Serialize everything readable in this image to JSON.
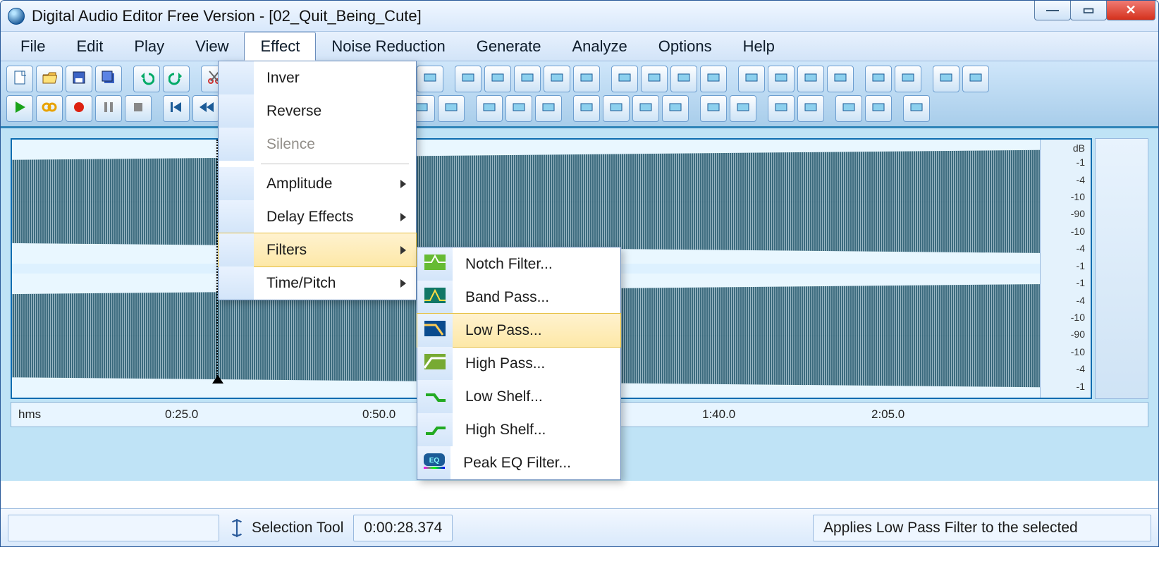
{
  "window": {
    "title": "Digital Audio Editor Free Version - [02_Quit_Being_Cute]"
  },
  "menubar": [
    "File",
    "Edit",
    "Play",
    "View",
    "Effect",
    "Noise Reduction",
    "Generate",
    "Analyze",
    "Options",
    "Help"
  ],
  "menubar_open": "Effect",
  "effect_menu": {
    "items": [
      {
        "label": "Inver",
        "kind": "item"
      },
      {
        "label": "Reverse",
        "kind": "item"
      },
      {
        "label": "Silence",
        "kind": "item",
        "disabled": true
      },
      {
        "kind": "sep"
      },
      {
        "label": "Amplitude",
        "kind": "sub"
      },
      {
        "label": "Delay Effects",
        "kind": "sub"
      },
      {
        "label": "Filters",
        "kind": "sub",
        "hover": true
      },
      {
        "label": "Time/Pitch",
        "kind": "sub"
      }
    ]
  },
  "filters_submenu": {
    "items": [
      {
        "label": "Notch Filter...",
        "icon": "notch"
      },
      {
        "label": "Band Pass...",
        "icon": "band"
      },
      {
        "label": "Low Pass...",
        "icon": "lowpass",
        "hover": true
      },
      {
        "label": "High Pass...",
        "icon": "highpass"
      },
      {
        "label": "Low Shelf...",
        "icon": "lowshelf"
      },
      {
        "label": "High Shelf...",
        "icon": "highshelf"
      },
      {
        "label": "Peak EQ Filter...",
        "icon": "eq"
      }
    ]
  },
  "toolbar_icons_row1": [
    "file-new",
    "file-open",
    "save",
    "save-all",
    "",
    "undo",
    "redo",
    "",
    "cut",
    "copy",
    "paste",
    "paste-new",
    "mix",
    "mix-new",
    "",
    "crop",
    "delete",
    "",
    "trim-start",
    "trim-end",
    "trim-both",
    "sel-start",
    "sel-end",
    "",
    "normalize",
    "amplify",
    "fade-in",
    "fade-out",
    "",
    "stretch",
    "reverse",
    "invert",
    "silence",
    "",
    "tone",
    "noise",
    "",
    "surround",
    "spectrum"
  ],
  "toolbar_icons_row2": [
    "play",
    "loop",
    "record",
    "pause",
    "stop",
    "",
    "prev",
    "rew",
    "fwd",
    "next",
    "",
    "zoom-in",
    "zoom-out",
    "zoom-sel",
    "zoom-full",
    "zoom-v-in",
    "zoom-v-out",
    "",
    "shuffle",
    "back",
    "equal",
    "",
    "ch-up",
    "ch-down",
    "ch-mono",
    "ch-stereo",
    "",
    "wave1",
    "wave2",
    "",
    "w-a",
    "w-b",
    "",
    "shelf1",
    "shelf2",
    "",
    "eq"
  ],
  "timeline": {
    "unit_label": "hms",
    "ticks": [
      "0:25.0",
      "0:50.0",
      "1:40.0",
      "2:05.0"
    ]
  },
  "db_scale": {
    "unit": "dB",
    "ticks_top": [
      "-1",
      "-4",
      "-10",
      "-90",
      "-10",
      "-4",
      "-1"
    ],
    "ticks_bot": [
      "-1",
      "-4",
      "-10",
      "-90",
      "-10",
      "-4",
      "-1"
    ]
  },
  "status": {
    "tool": "Selection Tool",
    "position": "0:00:28.374",
    "hint": "Applies Low Pass Filter to the selected"
  }
}
